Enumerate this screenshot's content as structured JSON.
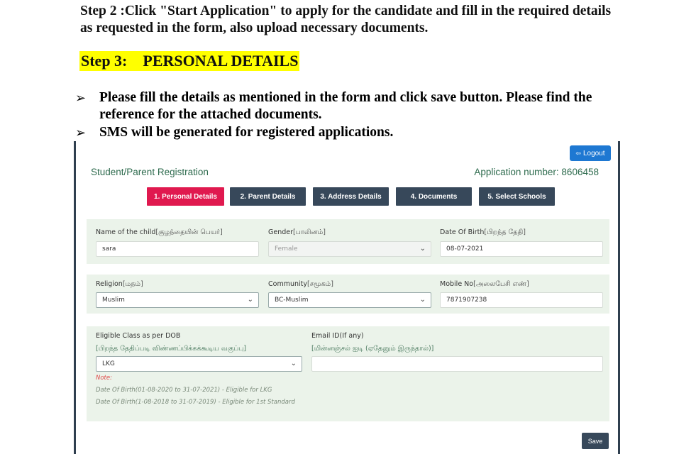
{
  "doc": {
    "step2": "Step 2 :Click \"Start Application\" to apply for the candidate and fill in the required details as requested in the form, also upload necessary documents.",
    "step3_label": "Step 3:",
    "step3_title": "PERSONAL DETAILS",
    "bullet_symbol": "➢",
    "bullets": [
      "Please fill the details as mentioned in the form and click save button. Please find the reference for the attached documents.",
      "SMS will be generated for registered applications."
    ]
  },
  "app": {
    "logout_label": "Logout",
    "title": "Student/Parent Registration",
    "application_number": "Application number: 8606458",
    "steps": [
      "1. Personal Details",
      "2. Parent Details",
      "3. Address Details",
      "4. Documents",
      "5. Select Schools"
    ],
    "active_step": 0,
    "fields": {
      "child_name": {
        "label": "Name of the child",
        "label_ta": "[குழந்தையின் பெயர்]",
        "value": "sara"
      },
      "gender": {
        "label": "Gender",
        "label_ta": "[பாலினம்]",
        "value": "Female"
      },
      "dob": {
        "label": "Date Of Birth",
        "label_ta": "[பிறந்த தேதி]",
        "value": "08-07-2021"
      },
      "religion": {
        "label": "Religion",
        "label_ta": "[மதம்]",
        "value": "Muslim"
      },
      "community": {
        "label": "Community",
        "label_ta": "[சமூகம்]",
        "value": "BC-Muslim"
      },
      "mobile": {
        "label": "Mobile No",
        "label_ta": "[அலைபேசி எண்]",
        "value": "7871907238"
      },
      "eligible_class": {
        "label": "Eligible Class as per DOB",
        "label_ta": "[பிறந்த தேதிப்படி விண்ணப்பிக்கக்கூடிய வகுப்பு]",
        "value": "LKG"
      },
      "email": {
        "label": "Email ID(If any)",
        "label_ta": "[மின்னஞ்சல் ஐடி (ஏதேனும் இருந்தால்)]",
        "value": ""
      }
    },
    "note_label": "Note:",
    "notes": [
      "Date Of Birth(01-08-2020 to 31-07-2021) - Eligible for LKG",
      "Date Of Birth(1-08-2018 to 31-07-2019) - Eligible for 1st Standard"
    ],
    "save_label": "Save",
    "colors": {
      "active_step": "#e0194f",
      "step": "#37485a",
      "logout": "#1e78d2",
      "row_bg": "#ebf3ea",
      "title_green": "#2e6b4e"
    }
  }
}
